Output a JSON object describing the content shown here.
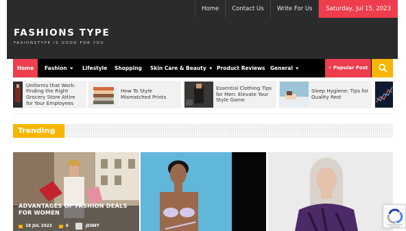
{
  "topnav": {
    "links": [
      "Home",
      "Contact Us",
      "Write For Us"
    ],
    "date": "Saturday, Jul 15, 2023"
  },
  "site": {
    "title": "FASHIONS TYPE",
    "tagline": "FASIONSTYPE IS GOOD FOR YOU"
  },
  "mainnav": {
    "items": [
      "Home",
      "Fashion",
      "Lifestyle",
      "Shopping",
      "Skin Care & Beauty",
      "Product Reviews",
      "General"
    ],
    "popular": "Popular Post"
  },
  "ticker": [
    {
      "line1": "Uniforms that Work:",
      "line2": "Finding the Right",
      "line3": "Grocery Store Attire",
      "line4": "for Your Employees"
    },
    {
      "line1": "How To Style",
      "line2": "Mismatched Prints"
    },
    {
      "line1": "Essential Clothing Tips",
      "line2": "for Men: Elevate Your",
      "line3": "Style Game"
    },
    {
      "line1": "Sleep Hygiene: Tips for",
      "line2": "Quality Rest"
    }
  ],
  "trending": {
    "label": "Trending"
  },
  "cards": [
    {
      "title_line1": "ADVANTAGES OF FASHION DEALS",
      "title_line2": "FOR WOMEN",
      "date": "18 JUL 2023",
      "comments": "0",
      "author": "JENNY"
    }
  ],
  "colors": {
    "accent_red": "#ee3d4c",
    "accent_yellow": "#f7b500",
    "header_dark": "#2b2b2b"
  }
}
